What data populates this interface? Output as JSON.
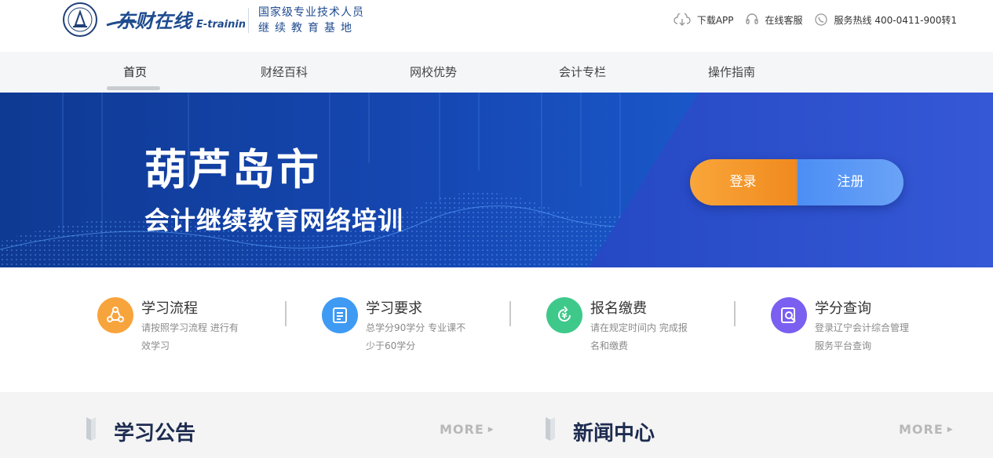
{
  "header": {
    "brand_name": "东财在线",
    "brand_sub": "E-training",
    "slogan_line1": "国家级专业技术人员",
    "slogan_line2": "继续教育基地",
    "download_app": "下载APP",
    "online_service": "在线客服",
    "hotline": "服务热线 400-0411-900转1"
  },
  "nav": {
    "items": [
      {
        "label": "首页",
        "active": true
      },
      {
        "label": "财经百科"
      },
      {
        "label": "网校优势"
      },
      {
        "label": "会计专栏"
      },
      {
        "label": "操作指南"
      }
    ]
  },
  "banner": {
    "title": "葫芦岛市",
    "subtitle": "会计继续教育网络培训",
    "login_label": "登录",
    "register_label": "注册"
  },
  "features": [
    {
      "title": "学习流程",
      "desc": "请按照学习流程 进行有效学习",
      "icon": "flow-icon",
      "color": "#f8a43c"
    },
    {
      "title": "学习要求",
      "desc": "总学分90学分 专业课不少于60学分",
      "icon": "requirement-icon",
      "color": "#3f9af4"
    },
    {
      "title": "报名缴费",
      "desc": "请在规定时间内 完成报名和缴费",
      "icon": "payment-icon",
      "color": "#3ec98a"
    },
    {
      "title": "学分查询",
      "desc": "登录辽宁会计综合管理服务平台查询",
      "icon": "credit-search-icon",
      "color": "#7b5ff0"
    }
  ],
  "sections": {
    "announcements_title": "学习公告",
    "news_title": "新闻中心",
    "more_label": "MORE"
  },
  "colors": {
    "brand_blue": "#1f4b8f",
    "banner_blue": "#1648b4",
    "login_orange": "#f59a2b",
    "register_blue": "#4c8ef5"
  }
}
